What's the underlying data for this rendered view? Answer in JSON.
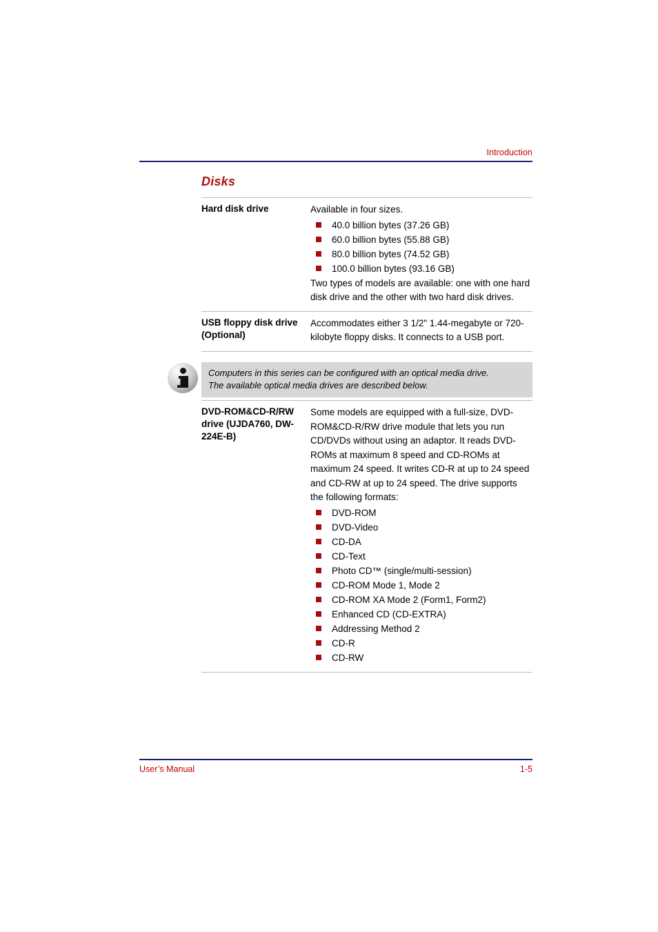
{
  "header": {
    "running_head": "Introduction"
  },
  "section": {
    "title": "Disks"
  },
  "table": {
    "rows": [
      {
        "label": "Hard disk drive",
        "intro": "Available in four sizes.",
        "bullets": [
          "40.0 billion bytes (37.26 GB)",
          "60.0 billion bytes (55.88 GB)",
          "80.0 billion bytes (74.52 GB)",
          "100.0 billion bytes (93.16 GB)"
        ],
        "outro": "Two types of models are available: one with one hard disk drive and the other with two hard disk drives."
      },
      {
        "label": "USB floppy disk drive (Optional)",
        "intro": "Accommodates either 3 1/2\" 1.44-megabyte or 720-kilobyte floppy disks. It connects to a USB port.",
        "bullets": [],
        "outro": ""
      },
      {
        "label": "DVD-ROM&CD-R/RW drive (UJDA760, DW-224E-B)",
        "intro": "Some models are equipped with a full-size, DVD-ROM&CD-R/RW drive module that lets you run CD/DVDs without using an adaptor. It reads DVD-ROMs at maximum 8 speed and CD-ROMs at maximum 24 speed. It writes CD-R at up to 24 speed and CD-RW at up to 24 speed. The drive supports the following formats:",
        "bullets": [
          "DVD-ROM",
          "DVD-Video",
          "CD-DA",
          "CD-Text",
          "Photo CD™ (single/multi-session)",
          "CD-ROM Mode 1, Mode 2",
          "CD-ROM XA Mode 2 (Form1, Form2)",
          "Enhanced CD (CD-EXTRA)",
          "Addressing Method 2",
          "CD-R",
          "CD-RW"
        ],
        "outro": ""
      }
    ]
  },
  "note": {
    "icon": "info-icon",
    "line1": "Computers in this series can be configured with an optical media drive.",
    "line2": "The available optical media drives are described below."
  },
  "footer": {
    "left": "User’s Manual",
    "right": "1-5"
  },
  "colors": {
    "accent_red": "#C00000",
    "heading_red": "#B01010",
    "bullet_red": "#A50E0E",
    "rule_navy": "#1B1B6F",
    "note_bg": "#D6D6D6",
    "table_rule": "#BBBBBB"
  }
}
